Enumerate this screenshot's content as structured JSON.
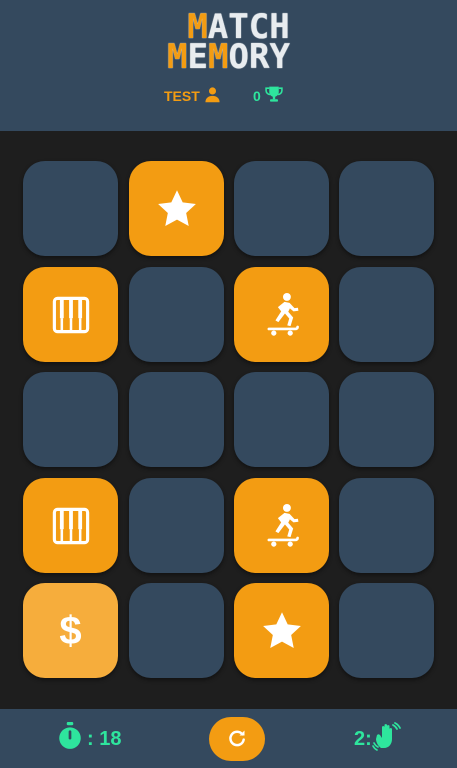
{
  "header": {
    "logo_line1_highlight": "M",
    "logo_line1_rest": "ATCH",
    "logo_line2_a": "M",
    "logo_line2_b": "E",
    "logo_line2_c": "M",
    "logo_line2_d": "O",
    "logo_line2_e": "RY",
    "player_name": "TEST",
    "player_icon": "user-icon",
    "score": "0",
    "score_icon": "trophy-icon"
  },
  "colors": {
    "header_bg": "#34495e",
    "board_bg": "#1e1e1e",
    "card_back": "#34495e",
    "card_face": "#f39c12",
    "accent_green": "#2ee59d"
  },
  "board": {
    "rows": 5,
    "cols": 4,
    "cards": [
      {
        "state": "hidden",
        "icon": ""
      },
      {
        "state": "revealed",
        "icon": "star-icon"
      },
      {
        "state": "hidden",
        "icon": ""
      },
      {
        "state": "hidden",
        "icon": ""
      },
      {
        "state": "revealed",
        "icon": "piano-icon"
      },
      {
        "state": "hidden",
        "icon": ""
      },
      {
        "state": "revealed",
        "icon": "skateboarder-icon"
      },
      {
        "state": "hidden",
        "icon": ""
      },
      {
        "state": "hidden",
        "icon": ""
      },
      {
        "state": "hidden",
        "icon": ""
      },
      {
        "state": "hidden",
        "icon": ""
      },
      {
        "state": "hidden",
        "icon": ""
      },
      {
        "state": "revealed",
        "icon": "piano-icon"
      },
      {
        "state": "hidden",
        "icon": ""
      },
      {
        "state": "revealed",
        "icon": "skateboarder-icon"
      },
      {
        "state": "hidden",
        "icon": ""
      },
      {
        "state": "selected",
        "icon": "dollar-icon",
        "glyph": "$"
      },
      {
        "state": "hidden",
        "icon": ""
      },
      {
        "state": "revealed",
        "icon": "star-icon"
      },
      {
        "state": "hidden",
        "icon": ""
      }
    ]
  },
  "footer": {
    "timer_icon": "stopwatch-icon",
    "timer_text": ": 18",
    "restart_icon": "restart-icon",
    "moves_text": "2:",
    "moves_icon": "waving-hand-icon"
  }
}
